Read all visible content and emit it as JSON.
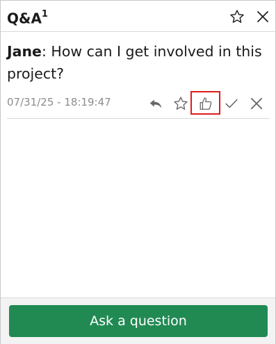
{
  "header": {
    "title": "Q&A",
    "count": "1",
    "star_icon": "star-outline-icon",
    "close_icon": "close-icon"
  },
  "message": {
    "author": "Jane",
    "separator": ": ",
    "text": "How can I get involved in this project?",
    "timestamp": "07/31/25 - 18:19:47"
  },
  "actions": [
    {
      "name": "reply",
      "icon": "reply-icon"
    },
    {
      "name": "star",
      "icon": "star-outline-icon"
    },
    {
      "name": "like",
      "icon": "thumbs-up-icon",
      "highlighted": true
    },
    {
      "name": "mark-answered",
      "icon": "check-icon"
    },
    {
      "name": "dismiss",
      "icon": "close-icon"
    }
  ],
  "footer": {
    "ask_label": "Ask a question"
  },
  "colors": {
    "primary_button": "#218a53",
    "highlight_border": "#e01b1b",
    "muted_text": "#8c8c8c"
  }
}
